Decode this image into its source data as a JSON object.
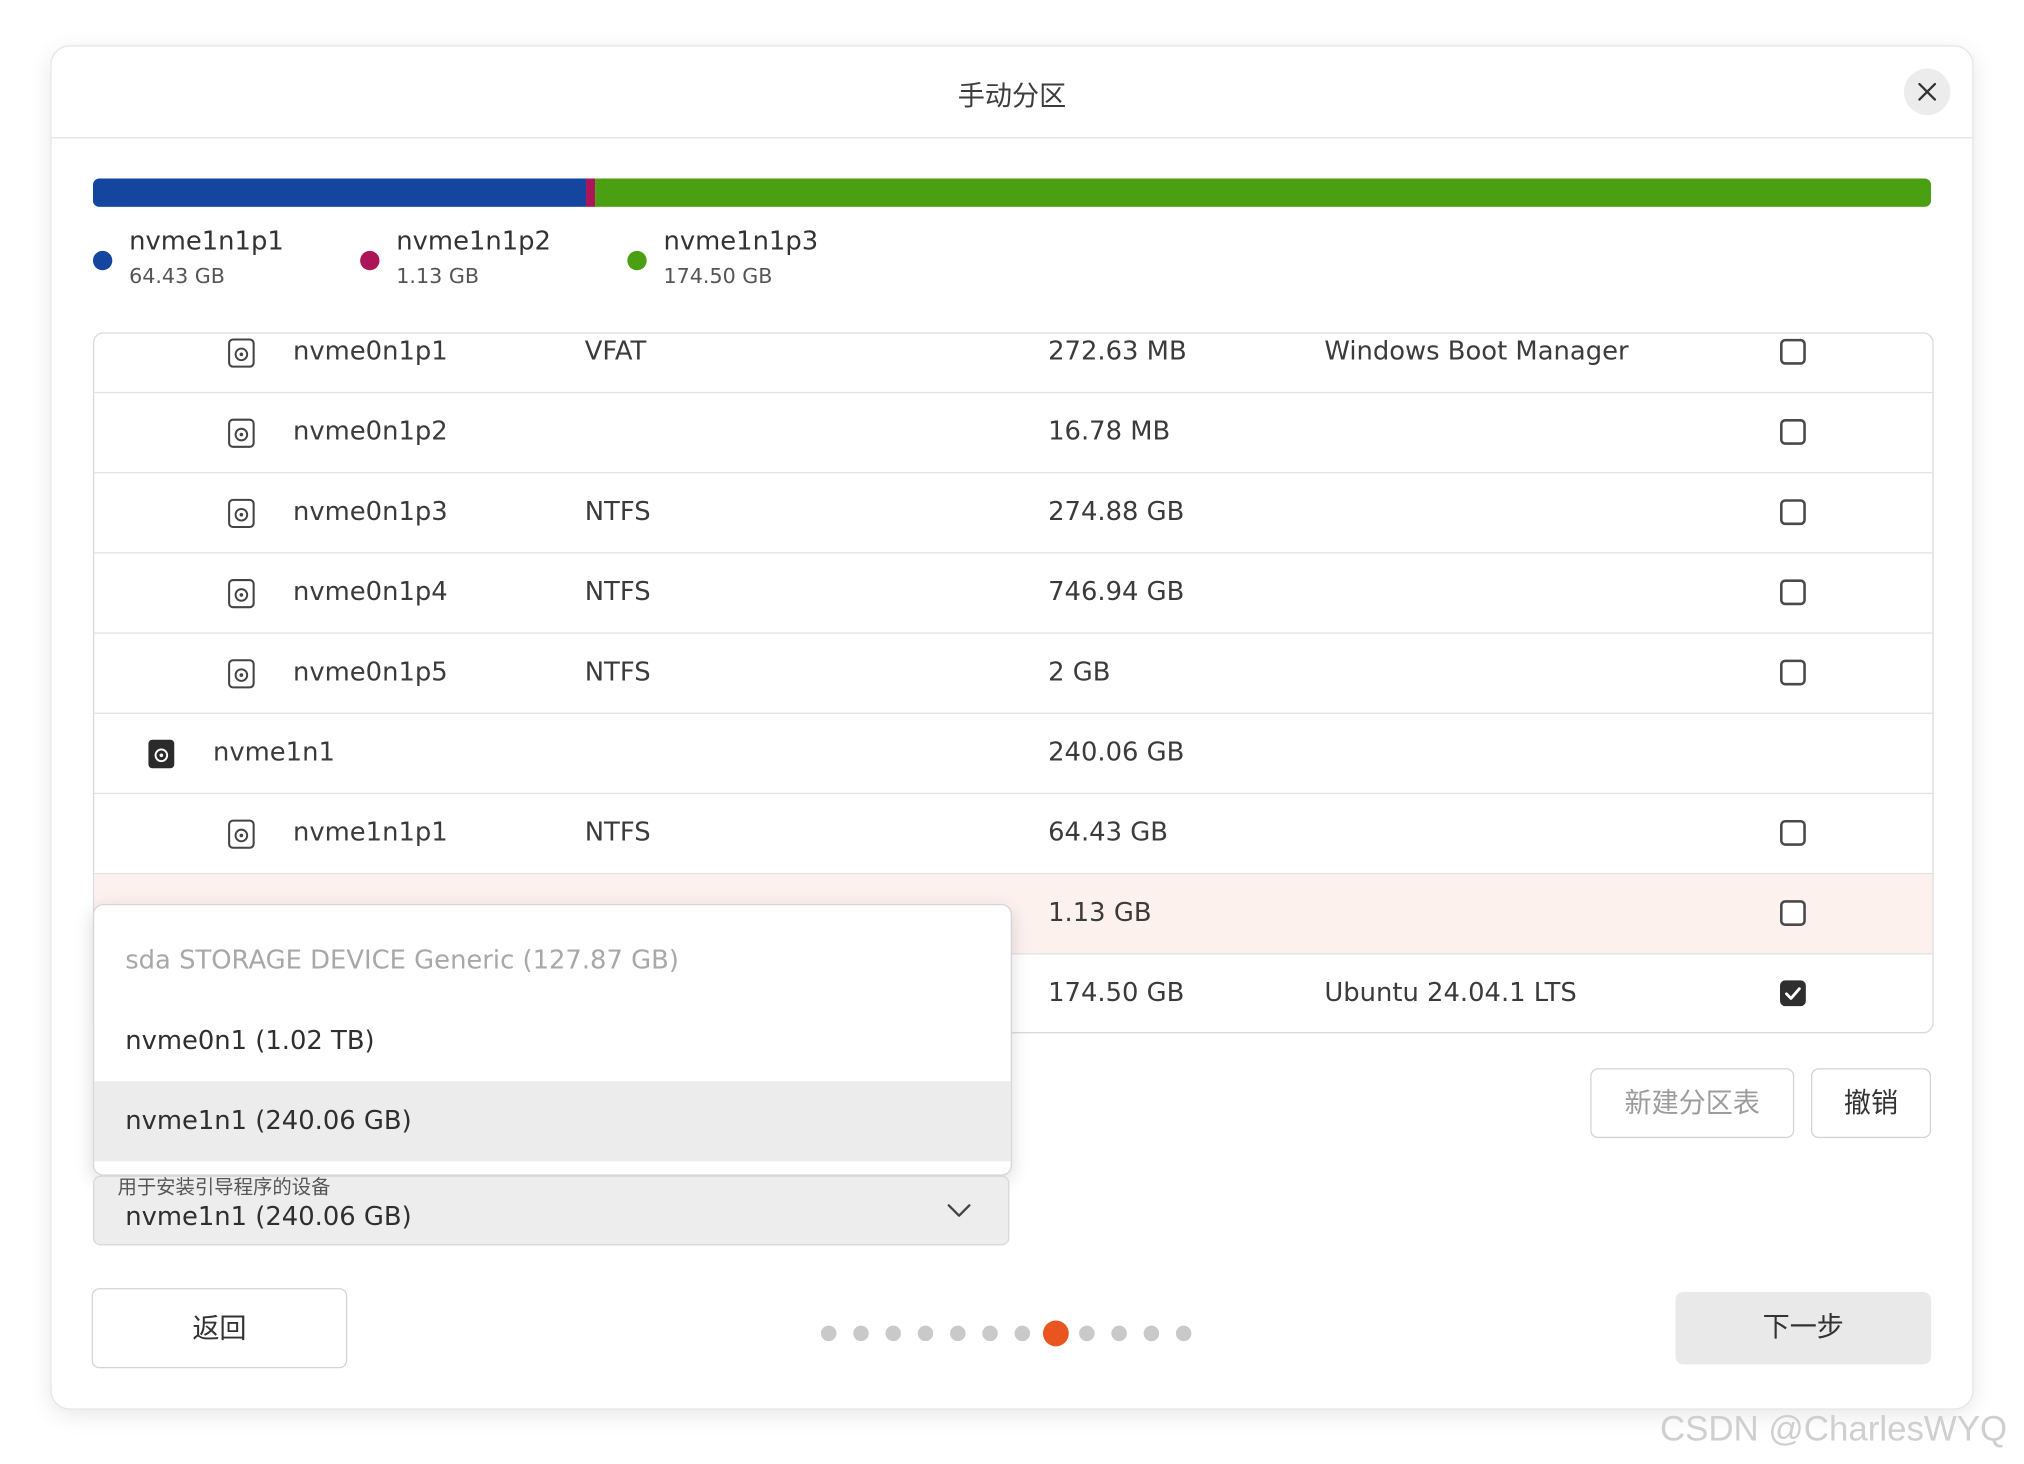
{
  "window": {
    "title": "手动分区",
    "close_icon": "close-icon"
  },
  "usage_bar": {
    "segments": [
      {
        "name": "nvme1n1p1",
        "size": "64.43 GB",
        "color": "#1446a0"
      },
      {
        "name": "nvme1n1p2",
        "size": "1.13 GB",
        "color": "#ac1557"
      },
      {
        "name": "nvme1n1p3",
        "size": "174.50 GB",
        "color": "#4aa012"
      }
    ]
  },
  "table": {
    "rows": [
      {
        "device": "nvme0n1p1",
        "type": "VFAT",
        "mount": "",
        "size": "272.63 MB",
        "system": "Windows Boot Manager",
        "format": false,
        "kind": "partition"
      },
      {
        "device": "nvme0n1p2",
        "type": "",
        "mount": "",
        "size": "16.78 MB",
        "system": "",
        "format": false,
        "kind": "partition"
      },
      {
        "device": "nvme0n1p3",
        "type": "NTFS",
        "mount": "",
        "size": "274.88 GB",
        "system": "",
        "format": false,
        "kind": "partition"
      },
      {
        "device": "nvme0n1p4",
        "type": "NTFS",
        "mount": "",
        "size": "746.94 GB",
        "system": "",
        "format": false,
        "kind": "partition"
      },
      {
        "device": "nvme0n1p5",
        "type": "NTFS",
        "mount": "",
        "size": "2 GB",
        "system": "",
        "format": false,
        "kind": "partition"
      },
      {
        "device": "nvme1n1",
        "type": "",
        "mount": "",
        "size": "240.06 GB",
        "system": "",
        "format": null,
        "kind": "disk"
      },
      {
        "device": "nvme1n1p1",
        "type": "NTFS",
        "mount": "",
        "size": "64.43 GB",
        "system": "",
        "format": false,
        "kind": "partition"
      },
      {
        "device": "",
        "type": "",
        "mount": "",
        "size": "1.13 GB",
        "system": "",
        "format": false,
        "kind": "partition",
        "highlighted": true
      },
      {
        "device": "",
        "type": "",
        "mount": "",
        "size": "174.50 GB",
        "system": "Ubuntu 24.04.1 LTS",
        "format": true,
        "kind": "partition"
      }
    ]
  },
  "dropdown": {
    "options": [
      {
        "label": "sda STORAGE DEVICE Generic (127.87 GB)",
        "disabled": true
      },
      {
        "label": "nvme0n1  (1.02 TB)",
        "disabled": false
      },
      {
        "label": "nvme1n1  (240.06 GB)",
        "disabled": false,
        "selected": true
      }
    ]
  },
  "boot_device": {
    "label": "用于安装引导程序的设备",
    "value": "nvme1n1  (240.06 GB)",
    "icon": "chevron-down-icon"
  },
  "actions": {
    "new_partition_table": "新建分区表",
    "revert": "撤销",
    "back": "返回",
    "next": "下一步"
  },
  "pager": {
    "total": 12,
    "active_index": 7
  },
  "watermark": "CSDN @CharlesWYQ"
}
